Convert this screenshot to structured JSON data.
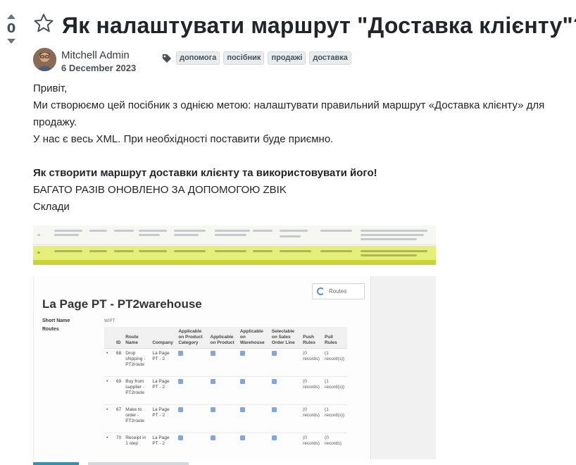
{
  "vote": {
    "count": "0"
  },
  "question": {
    "title": "Як налаштувати маршрут \"Доставка клієнту\"?"
  },
  "author": {
    "name": "Mitchell Admin",
    "date": "6 December 2023"
  },
  "tags": [
    "допомога",
    "посібник",
    "продажі",
    "доставка"
  ],
  "body": {
    "line1": "Привіт,",
    "line2": "Ми створюємо цей посібник з однією метою: налаштувати правильний маршрут «Доставка клієнту» для продажу.",
    "line3": "У нас є весь XML. При необхідності поставити буде приємно.",
    "heading": "Як створити маршрут доставки клієнту та використовувати його!",
    "line4": "БАГАТО РАЗІВ ОНОВЛЕНО ЗА ДОПОМОГОЮ ZBIK",
    "line5": "Склади"
  },
  "screenshot": {
    "routes_button": "Routes",
    "record_title": "La Page PT - PT2warehouse",
    "fields": [
      "Short Name",
      "Routes"
    ],
    "short_name_value": "W/PT",
    "columns": [
      "ID",
      "Route Name",
      "Company",
      "Applicable on Product Category",
      "Applicable on Product",
      "Applicable on Warehouse",
      "Selectable on Sales Order Line",
      "Push Rules",
      "Pull Rules"
    ],
    "rows": [
      {
        "id": "68",
        "name": "Drop shipping - PT2route",
        "company": "La Page PT - 2",
        "push": "(0 records)",
        "pull": "(1 record(s))"
      },
      {
        "id": "69",
        "name": "Buy from supplier - PT2route",
        "company": "La Page PT - 2",
        "push": "(0 records)",
        "pull": "(1 record(s))"
      },
      {
        "id": "67",
        "name": "Make to order - PT2route",
        "company": "La Page PT - 2",
        "push": "(0 records)",
        "pull": "(1 record(s))"
      },
      {
        "id": "70",
        "name": "Receipt in 1 step",
        "company": "La Page PT - 2",
        "push": "(0 records)",
        "pull": "(0 records)"
      }
    ]
  },
  "colors": {
    "text": "#212529",
    "tag_bg": "#e9ecef",
    "highlight_row": "#e6ee7a",
    "link_blue": "#5a8bd6"
  }
}
